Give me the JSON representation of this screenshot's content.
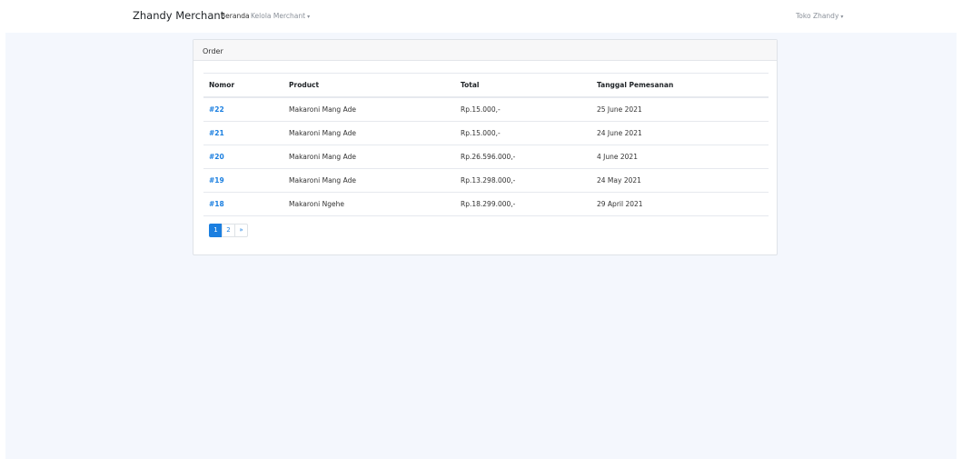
{
  "navbar": {
    "brand": "Zhandy Merchant",
    "links": [
      {
        "label": "Beranda"
      },
      {
        "label": "Kelola Merchant"
      }
    ],
    "user_menu": "Toko Zhandy",
    "caret": "▾"
  },
  "card": {
    "header": "Order",
    "columns": [
      "Nomor",
      "Product",
      "Total",
      "Tanggal Pemesanan"
    ],
    "rows": [
      {
        "nomor": "#22",
        "product": "Makaroni Mang Ade",
        "total": "Rp.15.000,-",
        "tanggal": "25 June 2021"
      },
      {
        "nomor": "#21",
        "product": "Makaroni Mang Ade",
        "total": "Rp.15.000,-",
        "tanggal": "24 June 2021"
      },
      {
        "nomor": "#20",
        "product": "Makaroni Mang Ade",
        "total": "Rp.26.596.000,-",
        "tanggal": "4 June 2021"
      },
      {
        "nomor": "#19",
        "product": "Makaroni Mang Ade",
        "total": "Rp.13.298.000,-",
        "tanggal": "24 May 2021"
      },
      {
        "nomor": "#18",
        "product": "Makaroni Ngehe",
        "total": "Rp.18.299.000,-",
        "tanggal": "29 April 2021"
      }
    ]
  },
  "pagination": {
    "pages": [
      "1",
      "2"
    ],
    "active": "1",
    "next": "»"
  },
  "colors": {
    "accent": "#1b7fe0",
    "background": "#f4f7fd"
  }
}
